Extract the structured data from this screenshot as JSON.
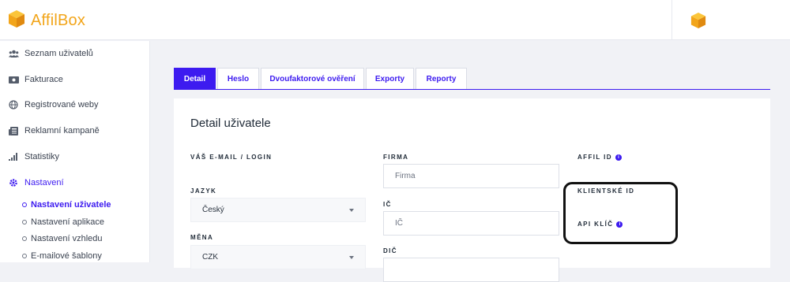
{
  "app": {
    "brand": "AffilBox",
    "brand_color": "#f2a51a",
    "accent_color": "#3d1bf0"
  },
  "page": {
    "heading": "Nastavení uživatele"
  },
  "sidebar": {
    "items": [
      {
        "label": "Seznam uživatelů",
        "icon": "users-icon"
      },
      {
        "label": "Fakturace",
        "icon": "money-icon"
      },
      {
        "label": "Registrované weby",
        "icon": "globe-icon"
      },
      {
        "label": "Reklamní kampaně",
        "icon": "newspaper-icon"
      },
      {
        "label": "Statistiky",
        "icon": "bar-chart-icon"
      },
      {
        "label": "Nastavení",
        "icon": "cog-icon",
        "active": true
      }
    ],
    "subitems": [
      {
        "label": "Nastavení uživatele",
        "active": true
      },
      {
        "label": "Nastavení aplikace"
      },
      {
        "label": "Nastavení vzhledu"
      },
      {
        "label": "E-mailové šablony"
      }
    ]
  },
  "tabs": [
    {
      "label": "Detail",
      "active": true
    },
    {
      "label": "Heslo"
    },
    {
      "label": "Dvoufaktorové ověření"
    },
    {
      "label": "Exporty"
    },
    {
      "label": "Reporty"
    }
  ],
  "card": {
    "title": "Detail uživatele",
    "fields": {
      "email_label": "VÁŠ E-MAIL / LOGIN",
      "language_label": "JAZYK",
      "language_value": "Český",
      "currency_label": "MĚNA",
      "currency_value": "CZK",
      "company_label": "FIRMA",
      "company_placeholder": "Firma",
      "ic_label": "IČ",
      "ic_placeholder": "IČ",
      "dic_label": "DIČ",
      "affil_id_label": "AFFIL ID",
      "client_id_label": "KLIENTSKÉ ID",
      "api_key_label": "API KLÍČ"
    }
  }
}
